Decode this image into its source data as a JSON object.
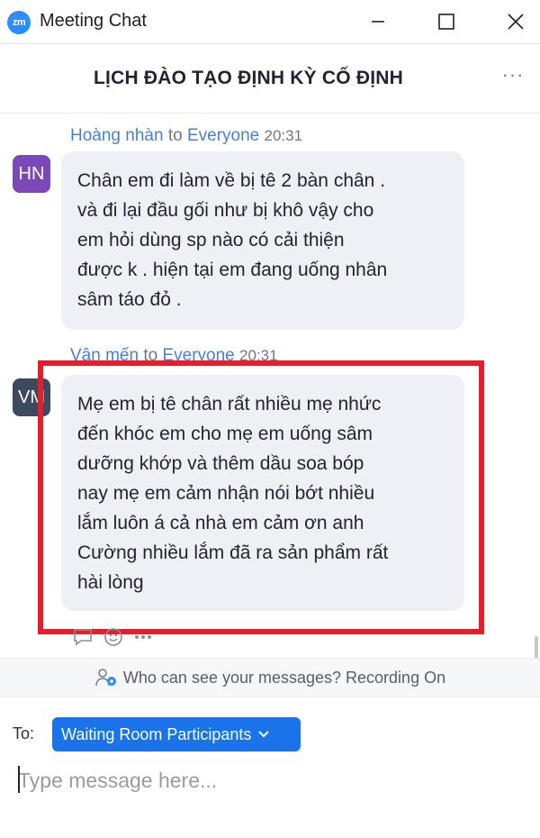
{
  "window": {
    "logo_text": "zm",
    "title": "Meeting Chat"
  },
  "header": {
    "title": "LỊCH ĐÀO TẠO ĐỊNH KỲ CỐ ĐỊNH",
    "more_label": "···"
  },
  "messages": [
    {
      "sender": "Hoàng nhàn",
      "to_word": "to",
      "recipient": "Everyone",
      "time": "20:31",
      "avatar_initials": "HN",
      "avatar_color": "#7b48b8",
      "lines": [
        "Chân em đi làm về bị tê 2 bàn chân .",
        "và đi lại đầu gối như bị khô vậy cho",
        "em hỏi dùng sp nào có cải thiện",
        "được k . hiện tại em đang uống nhân",
        "sâm táo đỏ ."
      ]
    },
    {
      "sender": "Vân mến",
      "to_word": "to",
      "recipient": "Everyone",
      "time": "20:31",
      "avatar_initials": "VM",
      "avatar_color": "#3b4a5c",
      "lines": [
        "Mẹ em bị tê chân rất nhiều mẹ nhức",
        "đến khóc em cho mẹ em uống sâm",
        "dưỡng khớp và thêm dầu soa bóp",
        "nay mẹ em cảm nhận nói bớt nhiều",
        "lắm luôn á cả nhà em cảm ơn anh",
        "Cường nhiều lắm đã ra sản phẩm rất",
        "hài lòng"
      ]
    }
  ],
  "notice": {
    "text": "Who can see your messages? Recording On"
  },
  "composer": {
    "to_label": "To:",
    "recipient": "Waiting Room Participants",
    "placeholder": "Type message here..."
  },
  "colors": {
    "accent": "#1a73e8",
    "highlight": "#e41e2b",
    "bubble": "#eef0f5",
    "sender_name": "#4a7fd6"
  }
}
